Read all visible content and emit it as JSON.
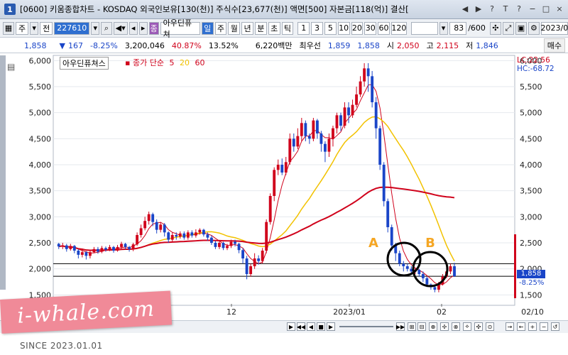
{
  "window": {
    "title": "[0600] 키움종합차트 - KOSDAQ 외국인보유[130(천)] 주식수[23,677(천)] 액면[500] 자본금[118(억)] 결산[",
    "app_icon": "1",
    "buttons": [
      "◀",
      "▶",
      "?",
      "T",
      "?",
      "−",
      "□",
      "×"
    ]
  },
  "toolbar": {
    "type1": "주",
    "type2": "전",
    "stock_code": "227610",
    "stock_name": "아우딘퓨쳐",
    "name_prefix": "종",
    "periods": [
      "일",
      "주",
      "월",
      "년",
      "분",
      "초",
      "틱"
    ],
    "minutes": [
      "1",
      "3",
      "5",
      "10",
      "20",
      "30",
      "60",
      "120"
    ],
    "count": "83",
    "count_total": "/600",
    "date": "2023/0",
    "buy_label": "매수"
  },
  "info": {
    "price": "1,858",
    "change": "167",
    "change_pct": "-8.25%",
    "volume": "3,200,046",
    "turnover_pct": "40.87%",
    "ratio": "13.52%",
    "amount": "6,220백만",
    "best_label": "최우선",
    "best1": "1,859",
    "best2": "1,858",
    "open_label": "시",
    "open": "2,050",
    "high_label": "고",
    "high": "2,115",
    "low_label": "저",
    "low": "1,846"
  },
  "chart": {
    "legend_name": "아우딘퓨쳐스",
    "indicator_label": "종가 단순",
    "ma_periods": [
      "5",
      "20",
      "60"
    ],
    "ma_colors": [
      "#d0021b",
      "#f2c200",
      "#d0021b"
    ],
    "lc_label": "LC:22.56",
    "hc_label": "HC:-68.72",
    "last_price_label": "1,858",
    "last_pct_label": "-8.25%",
    "annotation_a": "A",
    "annotation_b": "B",
    "x_ticks": [
      "12",
      "2023/01",
      "02",
      "02/10"
    ],
    "y_ticks": [
      "6,000",
      "5,500",
      "5,000",
      "4,500",
      "4,000",
      "3,500",
      "3,000",
      "2,500",
      "2,000",
      "1,500"
    ]
  },
  "chart_data": {
    "type": "candlestick",
    "ylim": [
      1300,
      6100
    ],
    "y_ticks": [
      6000,
      5500,
      5000,
      4500,
      4000,
      3500,
      3000,
      2500,
      2000,
      1500
    ],
    "candles": [
      [
        2480,
        2430,
        2500,
        2380
      ],
      [
        2430,
        2450,
        2500,
        2380
      ],
      [
        2450,
        2380,
        2480,
        2330
      ],
      [
        2380,
        2440,
        2480,
        2350
      ],
      [
        2440,
        2350,
        2460,
        2300
      ],
      [
        2350,
        2270,
        2380,
        2200
      ],
      [
        2270,
        2320,
        2370,
        2220
      ],
      [
        2320,
        2250,
        2340,
        2180
      ],
      [
        2250,
        2320,
        2360,
        2200
      ],
      [
        2320,
        2380,
        2420,
        2300
      ],
      [
        2380,
        2330,
        2420,
        2290
      ],
      [
        2330,
        2400,
        2440,
        2300
      ],
      [
        2400,
        2370,
        2430,
        2330
      ],
      [
        2370,
        2420,
        2460,
        2340
      ],
      [
        2420,
        2350,
        2440,
        2310
      ],
      [
        2350,
        2420,
        2460,
        2330
      ],
      [
        2420,
        2480,
        2520,
        2380
      ],
      [
        2480,
        2420,
        2500,
        2380
      ],
      [
        2420,
        2380,
        2440,
        2330
      ],
      [
        2380,
        2470,
        2500,
        2340
      ],
      [
        2470,
        2650,
        2700,
        2440
      ],
      [
        2650,
        2780,
        2850,
        2600
      ],
      [
        2780,
        2920,
        3000,
        2740
      ],
      [
        2920,
        3050,
        3100,
        2850
      ],
      [
        3050,
        2900,
        3080,
        2820
      ],
      [
        2900,
        2750,
        2950,
        2680
      ],
      [
        2750,
        2850,
        2900,
        2700
      ],
      [
        2850,
        2700,
        2880,
        2620
      ],
      [
        2700,
        2560,
        2720,
        2500
      ],
      [
        2560,
        2650,
        2700,
        2520
      ],
      [
        2650,
        2620,
        2700,
        2560
      ],
      [
        2620,
        2680,
        2720,
        2580
      ],
      [
        2680,
        2600,
        2720,
        2560
      ],
      [
        2600,
        2700,
        2740,
        2560
      ],
      [
        2700,
        2640,
        2740,
        2600
      ],
      [
        2640,
        2700,
        2760,
        2600
      ],
      [
        2700,
        2750,
        2780,
        2660
      ],
      [
        2750,
        2660,
        2770,
        2620
      ],
      [
        2660,
        2600,
        2700,
        2540
      ],
      [
        2600,
        2500,
        2640,
        2460
      ],
      [
        2500,
        2420,
        2540,
        2380
      ],
      [
        2420,
        2500,
        2540,
        2380
      ],
      [
        2500,
        2400,
        2520,
        2360
      ],
      [
        2400,
        2440,
        2480,
        2360
      ],
      [
        2440,
        2520,
        2560,
        2400
      ],
      [
        2520,
        2480,
        2560,
        2430
      ],
      [
        2480,
        2360,
        2500,
        2300
      ],
      [
        2360,
        2200,
        2400,
        2100
      ],
      [
        2200,
        1900,
        2250,
        1800
      ],
      [
        1900,
        2050,
        2100,
        1850
      ],
      [
        2050,
        2200,
        2300,
        2000
      ],
      [
        2200,
        2150,
        2260,
        2080
      ],
      [
        2150,
        2350,
        2400,
        2100
      ],
      [
        2350,
        2900,
        2950,
        2300
      ],
      [
        2900,
        3400,
        3450,
        2850
      ],
      [
        3400,
        3900,
        3950,
        3300
      ],
      [
        3900,
        4000,
        4100,
        3800
      ],
      [
        4000,
        3850,
        4120,
        3800
      ],
      [
        3850,
        4050,
        4150,
        3800
      ],
      [
        4050,
        4500,
        4600,
        4000
      ],
      [
        4500,
        4350,
        4600,
        4250
      ],
      [
        4350,
        4550,
        4700,
        4300
      ],
      [
        4550,
        4800,
        4900,
        4450
      ],
      [
        4800,
        4550,
        4850,
        4450
      ],
      [
        4550,
        4500,
        4600,
        4400
      ],
      [
        4500,
        4850,
        4900,
        4450
      ],
      [
        4850,
        4600,
        4880,
        4500
      ],
      [
        4600,
        4400,
        4650,
        4250
      ],
      [
        4400,
        4250,
        4450,
        4050
      ],
      [
        4250,
        4500,
        4600,
        4150
      ],
      [
        4500,
        4700,
        4750,
        4350
      ],
      [
        4700,
        4950,
        5000,
        4600
      ],
      [
        4950,
        4750,
        5000,
        4650
      ],
      [
        4750,
        5100,
        5200,
        4700
      ],
      [
        5100,
        4950,
        5200,
        4800
      ],
      [
        4950,
        5150,
        5250,
        4900
      ],
      [
        5150,
        5350,
        5500,
        5100
      ],
      [
        5350,
        5600,
        5700,
        5300
      ],
      [
        5600,
        5850,
        5950,
        5500
      ],
      [
        5850,
        5700,
        5950,
        5400
      ],
      [
        5700,
        5200,
        5800,
        5100
      ],
      [
        5200,
        4700,
        5300,
        4500
      ],
      [
        4700,
        4000,
        4750,
        3900
      ],
      [
        4000,
        3300,
        4050,
        3200
      ],
      [
        3300,
        2800,
        3350,
        2700
      ],
      [
        2800,
        2450,
        2850,
        2350
      ],
      [
        2450,
        2300,
        2500,
        2150
      ],
      [
        2300,
        2100,
        2350,
        2050
      ],
      [
        2100,
        2050,
        2150,
        1950
      ],
      [
        2050,
        2000,
        2100,
        1950
      ],
      [
        2000,
        1950,
        2050,
        1900
      ],
      [
        1950,
        1980,
        2020,
        1900
      ],
      [
        1980,
        1900,
        2000,
        1850
      ],
      [
        1900,
        1820,
        1950,
        1750
      ],
      [
        1820,
        1700,
        1850,
        1650
      ],
      [
        1700,
        1650,
        1720,
        1600
      ],
      [
        1650,
        1600,
        1700,
        1550
      ],
      [
        1600,
        1700,
        1750,
        1550
      ],
      [
        1700,
        1850,
        1900,
        1680
      ],
      [
        1850,
        1950,
        2050,
        1820
      ],
      [
        1950,
        2050,
        2100,
        1900
      ],
      [
        2050,
        1858,
        2115,
        1846
      ]
    ],
    "horizontal_lines": [
      2100,
      1858
    ],
    "circles": [
      "A",
      "B"
    ]
  },
  "bottom": {
    "nav_buttons": [
      "▶",
      "◀◀",
      "◀",
      "■",
      "▶",
      "▶▶"
    ]
  },
  "watermark": {
    "text": "i-whale.com",
    "since": "SINCE 2023.01.01"
  }
}
